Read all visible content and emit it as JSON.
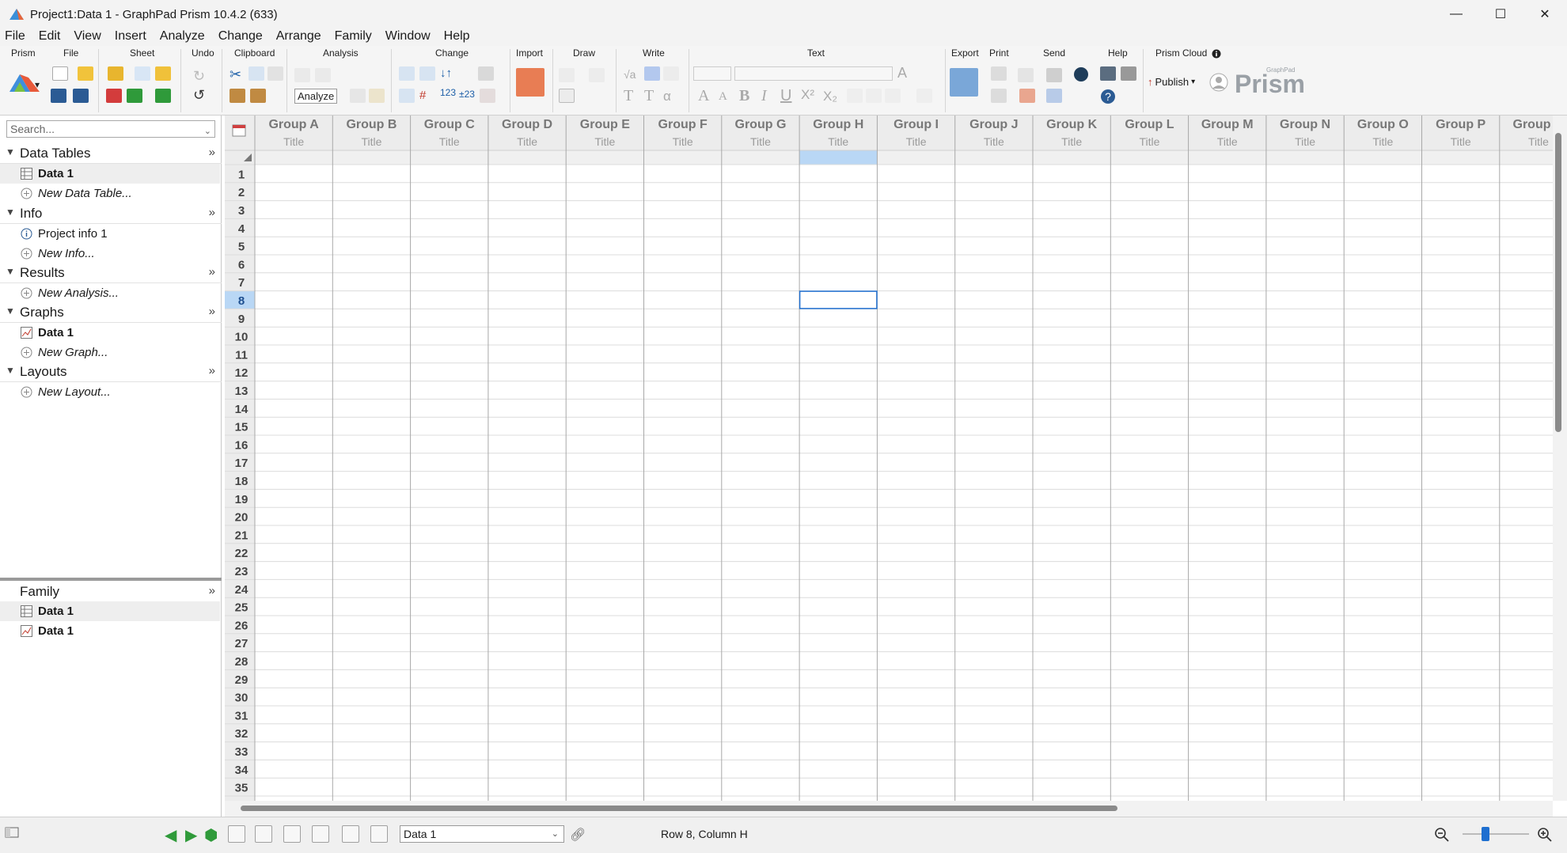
{
  "window": {
    "title": "Project1:Data 1 - GraphPad Prism 10.4.2 (633)",
    "minimize": "—",
    "maximize": "☐",
    "close": "✕"
  },
  "menu": [
    "File",
    "Edit",
    "View",
    "Insert",
    "Analyze",
    "Change",
    "Arrange",
    "Family",
    "Window",
    "Help"
  ],
  "toolbar": {
    "groups": [
      "Prism",
      "File",
      "Sheet",
      "Undo",
      "Clipboard",
      "Analysis",
      "Change",
      "Import",
      "Draw",
      "Write",
      "Text",
      "Export",
      "Print",
      "Send",
      "Help",
      "Prism Cloud"
    ],
    "analyze_label": "Analyze",
    "publish_label": "Publish",
    "brand_small": "GraphPad",
    "brand": "Prism"
  },
  "sidebar": {
    "search_placeholder": "Search...",
    "sections": [
      {
        "label": "Data Tables",
        "items": [
          {
            "label": "Data 1",
            "style": "bold",
            "icon": "table-icon",
            "selected": true
          },
          {
            "label": "New Data Table...",
            "style": "italic",
            "icon": "plus-circle-icon"
          }
        ]
      },
      {
        "label": "Info",
        "items": [
          {
            "label": "Project info 1",
            "style": "normal",
            "icon": "info-icon"
          },
          {
            "label": "New Info...",
            "style": "italic",
            "icon": "plus-circle-icon"
          }
        ]
      },
      {
        "label": "Results",
        "items": [
          {
            "label": "New Analysis...",
            "style": "italic",
            "icon": "plus-circle-icon"
          }
        ]
      },
      {
        "label": "Graphs",
        "items": [
          {
            "label": "Data 1",
            "style": "bold",
            "icon": "graph-icon"
          },
          {
            "label": "New Graph...",
            "style": "italic",
            "icon": "plus-circle-icon"
          }
        ]
      },
      {
        "label": "Layouts",
        "items": [
          {
            "label": "New Layout...",
            "style": "italic",
            "icon": "plus-circle-icon"
          }
        ]
      }
    ],
    "family": {
      "label": "Family",
      "items": [
        {
          "label": "Data 1",
          "icon": "table-icon",
          "selected": true
        },
        {
          "label": "Data 1",
          "icon": "graph-icon"
        }
      ]
    }
  },
  "grid": {
    "columns": [
      "Group A",
      "Group B",
      "Group C",
      "Group D",
      "Group E",
      "Group F",
      "Group G",
      "Group H",
      "Group I",
      "Group J",
      "Group K",
      "Group L",
      "Group M",
      "Group N",
      "Group O",
      "Group P",
      "Group Q"
    ],
    "subtitle": "Title",
    "rows": [
      "1",
      "2",
      "3",
      "4",
      "5",
      "6",
      "7",
      "8",
      "9",
      "10",
      "11",
      "12",
      "13",
      "14",
      "15",
      "16",
      "17",
      "18",
      "19",
      "20",
      "21",
      "22",
      "23",
      "24",
      "25",
      "26",
      "27",
      "28",
      "29",
      "30",
      "31",
      "32",
      "33",
      "34",
      "35"
    ],
    "selected_column": "Group H",
    "selected_row": "8"
  },
  "status": {
    "sheet": "Data 1",
    "position": "Row 8, Column H"
  },
  "colors": {
    "accent_selection": "#b9d7f5",
    "cell_border": "#1e6fd0"
  }
}
